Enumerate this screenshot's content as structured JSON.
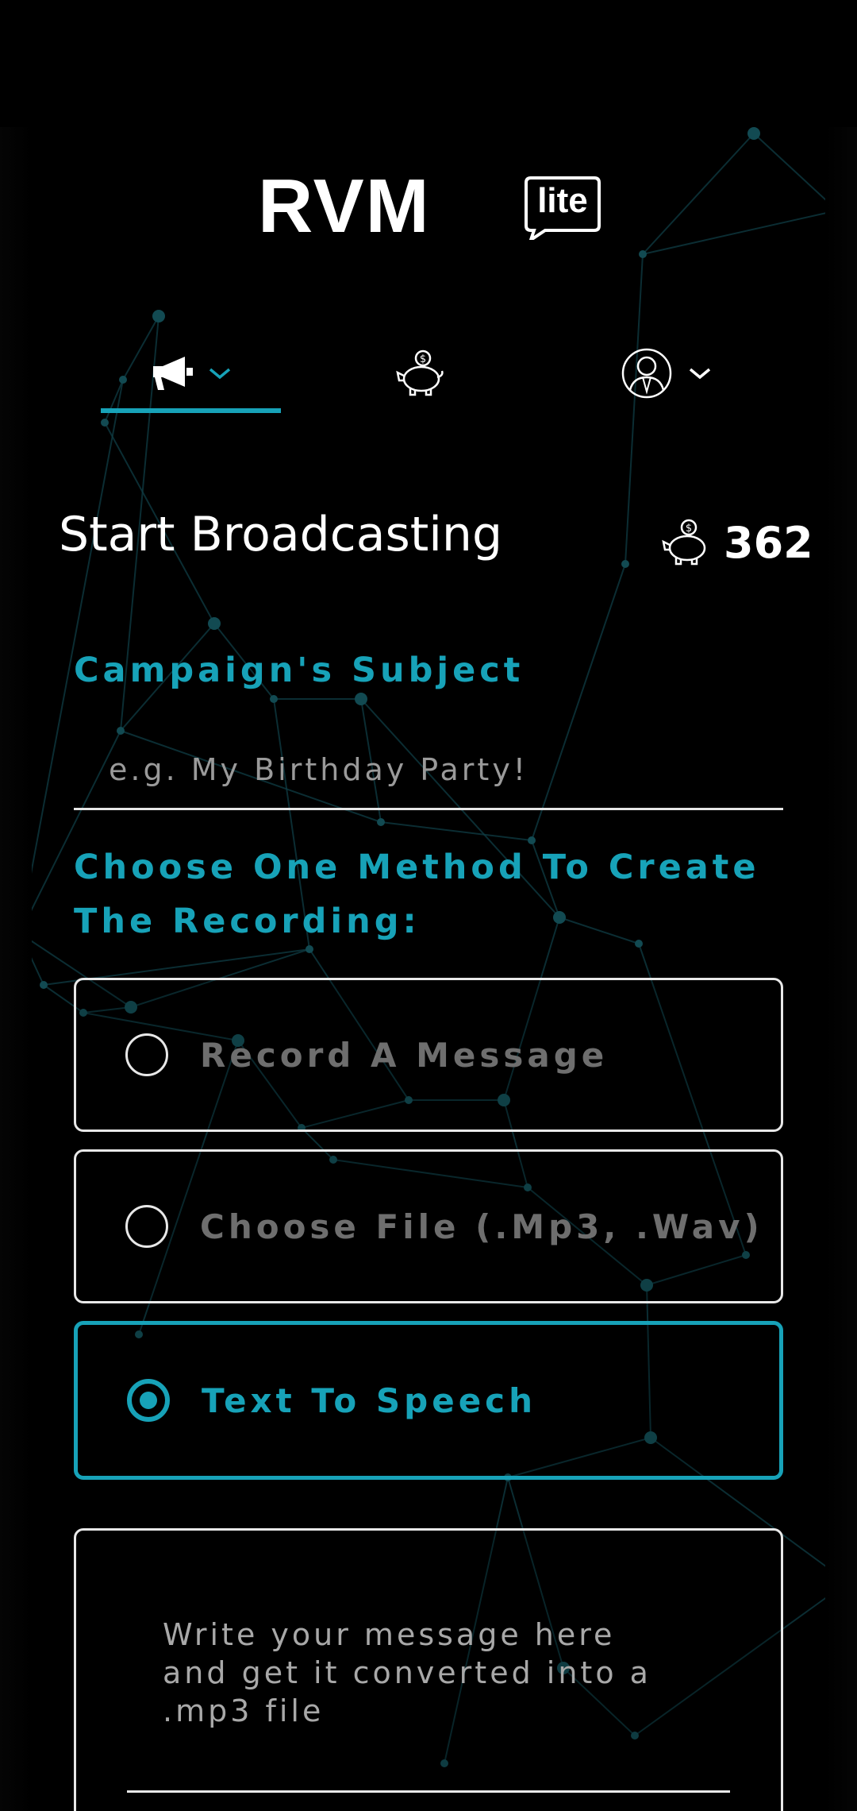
{
  "logo": {
    "main": "RVM",
    "badge": "lite"
  },
  "nav": {
    "items": [
      {
        "id": "campaign",
        "icon": "megaphone-icon",
        "has_dropdown": true,
        "active": true
      },
      {
        "id": "credits",
        "icon": "piggy-bank-icon",
        "has_dropdown": false,
        "active": false
      },
      {
        "id": "account",
        "icon": "user-avatar-icon",
        "has_dropdown": true,
        "active": false
      }
    ]
  },
  "header": {
    "title": "Start Broadcasting",
    "balance": "362",
    "balance_icon": "piggy-bank-icon"
  },
  "subject": {
    "label": "Campaign's Subject",
    "placeholder": "e.g. My Birthday Party!",
    "value": ""
  },
  "method": {
    "label": "Choose One Method To Create The Recording:",
    "options": [
      {
        "label": "Record A Message",
        "selected": false
      },
      {
        "label": "Choose File (.Mp3, .Wav)",
        "selected": false
      },
      {
        "label": "Text To Speech",
        "selected": true
      }
    ]
  },
  "tts": {
    "placeholder": "Write your message here and get it converted into a .mp3 file",
    "value": ""
  },
  "colors": {
    "accent": "#17a2b8",
    "background": "#000000",
    "text": "#ffffff",
    "muted": "#6e6e6e"
  }
}
